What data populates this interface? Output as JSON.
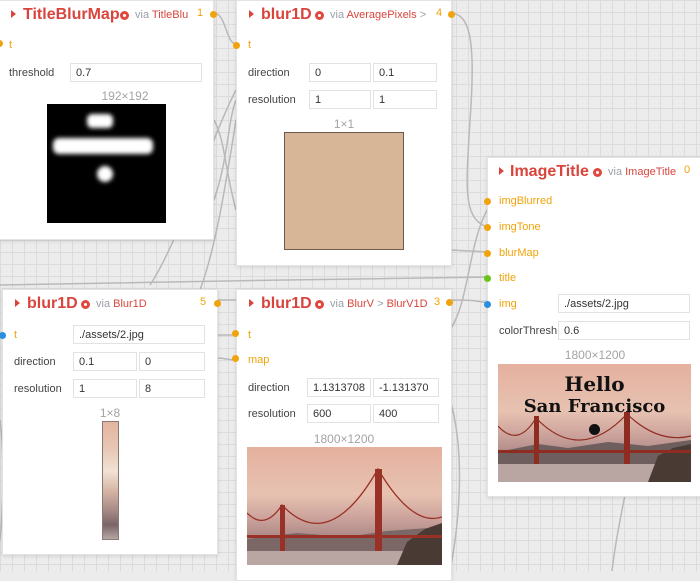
{
  "nodes": {
    "title_blur_map": {
      "name": "TitleBlurMap",
      "via_prefix": "via",
      "via_link": "TitleBlu",
      "count": "1",
      "input_t": "t",
      "threshold_label": "threshold",
      "threshold_value": "0.7",
      "image_dims": "192×192",
      "preview_text": "Hello San Francisco"
    },
    "blur1d_average": {
      "name": "blur1D",
      "via_prefix": "via",
      "via_link": "AveragePixels",
      "via_suffix": ">",
      "count": "4",
      "input_t": "t",
      "direction_label": "direction",
      "direction_x": "0",
      "direction_y": "0.1",
      "resolution_label": "resolution",
      "resolution_x": "1",
      "resolution_y": "1",
      "image_dims": "1×1",
      "swatch_color": "#d7b597"
    },
    "image_title": {
      "name": "ImageTitle",
      "via_prefix": "via",
      "via_link": "ImageTitle",
      "count": "0",
      "inputs": [
        "imgBlurred",
        "imgTone",
        "blurMap",
        "title",
        "img"
      ],
      "img_value": "./assets/2.jpg",
      "color_thresh_label": "colorThresh",
      "color_thresh_value": "0.6",
      "image_dims": "1800×1200",
      "title_line1": "Hello",
      "title_line2": "San Francisco"
    },
    "blur1d_left": {
      "name": "blur1D",
      "via_prefix": "via",
      "via_link": "Blur1D",
      "count": "5",
      "input_t": "t",
      "t_value": "./assets/2.jpg",
      "direction_label": "direction",
      "direction_x": "0.1",
      "direction_y": "0",
      "resolution_label": "resolution",
      "resolution_x": "1",
      "resolution_y": "8",
      "image_dims": "1×8"
    },
    "blur1d_blurv": {
      "name": "blur1D",
      "via_prefix": "via",
      "via_link": "BlurV",
      "via_mid": ">",
      "via_link2": "BlurV1D",
      "count": "3",
      "input_t": "t",
      "input_map": "map",
      "direction_label": "direction",
      "direction_x": "1.1313708",
      "direction_y": "-1.131370",
      "resolution_label": "resolution",
      "resolution_x": "600",
      "resolution_y": "400",
      "image_dims": "1800×1200"
    }
  },
  "colors": {
    "accent_red": "#d9453d",
    "port_orange": "#f0a30a",
    "port_blue": "#2a8de0",
    "port_green": "#6cc419"
  }
}
